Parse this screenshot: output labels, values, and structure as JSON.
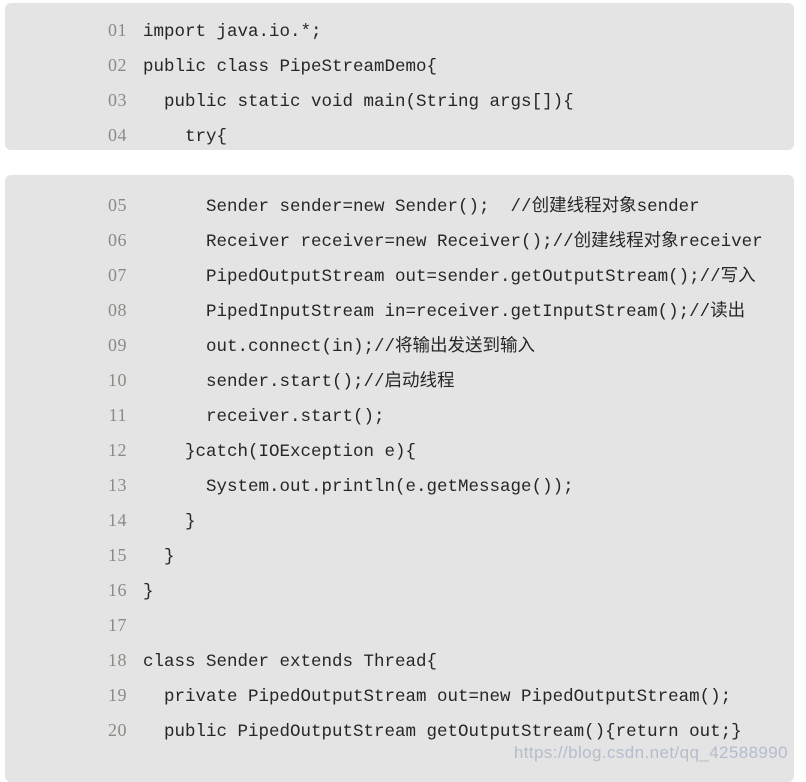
{
  "document": {
    "language": "java",
    "background_color": "#ffffff",
    "block_background_color": "#e4e4e4",
    "line_number_color": "#8a8a86",
    "code_text_color": "#262626"
  },
  "blocks": [
    {
      "id": "block-one",
      "lines": [
        {
          "number": "01",
          "text": "import java.io.*;"
        },
        {
          "number": "02",
          "text": "public class PipeStreamDemo{"
        },
        {
          "number": "03",
          "text": "  public static void main(String args[]){"
        },
        {
          "number": "04",
          "text": "    try{"
        }
      ]
    },
    {
      "id": "block-two",
      "lines": [
        {
          "number": "05",
          "text": "      Sender sender=new Sender();  //创建线程对象sender"
        },
        {
          "number": "06",
          "text": "      Receiver receiver=new Receiver();//创建线程对象receiver"
        },
        {
          "number": "07",
          "text": "      PipedOutputStream out=sender.getOutputStream();//写入"
        },
        {
          "number": "08",
          "text": "      PipedInputStream in=receiver.getInputStream();//读出"
        },
        {
          "number": "09",
          "text": "      out.connect(in);//将输出发送到输入"
        },
        {
          "number": "10",
          "text": "      sender.start();//启动线程"
        },
        {
          "number": "11",
          "text": "      receiver.start();"
        },
        {
          "number": "12",
          "text": "    }catch(IOException e){"
        },
        {
          "number": "13",
          "text": "      System.out.println(e.getMessage());"
        },
        {
          "number": "14",
          "text": "    }"
        },
        {
          "number": "15",
          "text": "  }"
        },
        {
          "number": "16",
          "text": "}"
        },
        {
          "number": "17",
          "text": ""
        },
        {
          "number": "18",
          "text": "class Sender extends Thread{"
        },
        {
          "number": "19",
          "text": "  private PipedOutputStream out=new PipedOutputStream();"
        },
        {
          "number": "20",
          "text": "  public PipedOutputStream getOutputStream(){return out;}"
        }
      ]
    }
  ],
  "watermark": {
    "text": "https://blog.csdn.net/qq_42588990"
  }
}
